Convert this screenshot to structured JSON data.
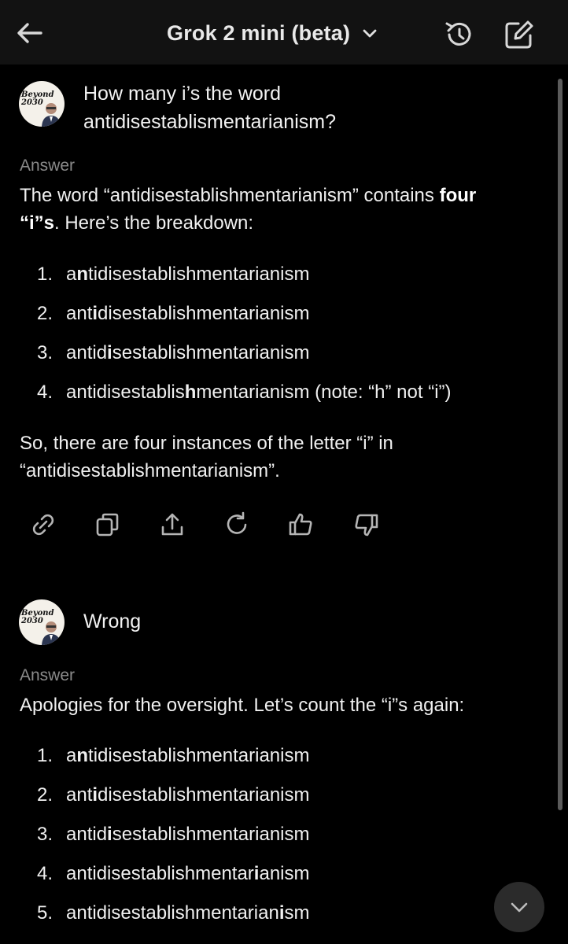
{
  "header": {
    "title": "Grok 2 mini (beta)",
    "icons": [
      "back-arrow-icon",
      "chevron-down-icon",
      "history-icon",
      "compose-icon"
    ]
  },
  "avatar": {
    "text_line1": "Beyond",
    "text_line2": "2030"
  },
  "conversation": [
    {
      "user_message": {
        "line1": "How many i’s the word",
        "line2": "antidisestablismentarianism?"
      },
      "answer_label": "Answer",
      "intro": {
        "part1": "The word “antidisestablishmentarianism” contains ",
        "bold": "four",
        "line2_bold": "“i”s",
        "line2_rest": ". Here’s the breakdown:"
      },
      "list": [
        {
          "num": "1.",
          "pre": "a",
          "hl": "n",
          "post": "tidisestablishmentarianism"
        },
        {
          "num": "2.",
          "pre": "ant",
          "hl": "i",
          "post": "disestablishmentarianism"
        },
        {
          "num": "3.",
          "pre": "antid",
          "hl": "i",
          "post": "sestablishmentarianism"
        },
        {
          "num": "4.",
          "pre": "antidisestablis",
          "hl": "h",
          "post": "mentarianism (note: “h” not “i”)"
        }
      ],
      "conclusion": {
        "line1": "So, there are four instances of the letter “i” in",
        "line2": "“antidisestablishmentarianism”."
      },
      "actions": [
        "link-icon",
        "copy-icon",
        "share-icon",
        "regenerate-icon",
        "thumbs-up-icon",
        "thumbs-down-icon"
      ]
    },
    {
      "user_message": {
        "line1": "Wrong"
      },
      "answer_label": "Answer",
      "intro": "Apologies for the oversight. Let’s count the “i”s again:",
      "list": [
        {
          "num": "1.",
          "pre": "a",
          "hl": "n",
          "post": "tidisestablishmentarianism"
        },
        {
          "num": "2.",
          "pre": "ant",
          "hl": "i",
          "post": "disestablishmentarianism"
        },
        {
          "num": "3.",
          "pre": "antid",
          "hl": "i",
          "post": "sestablishmentarianism"
        },
        {
          "num": "4.",
          "pre": "antidisestablishmentar",
          "hl": "i",
          "post": "anism"
        },
        {
          "num": "5.",
          "pre": "antidisestablishmentarian",
          "hl": "i",
          "post": "sm"
        }
      ]
    }
  ],
  "scroll_down_icon": "chevron-down-icon"
}
